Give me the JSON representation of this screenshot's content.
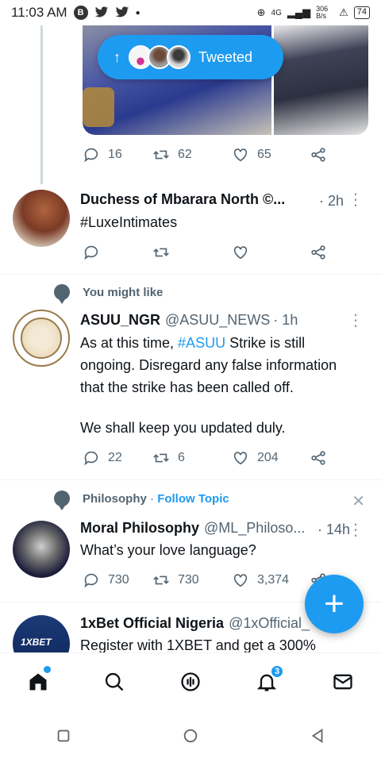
{
  "status_bar": {
    "time": "11:03 AM",
    "notif_letter": "B",
    "net_speed": "306 B/s",
    "network": "4G",
    "battery": "74"
  },
  "tweeted_pill": {
    "label": "Tweeted"
  },
  "tweets": [
    {
      "reply_count": "16",
      "retweet_count": "62",
      "like_count": "65"
    },
    {
      "name": "Duchess of Mbarara North ©...",
      "time": "· 2h",
      "text": "#LuxeIntimates",
      "reply_count": "",
      "retweet_count": "",
      "like_count": ""
    },
    {
      "context": "You might like",
      "name": "ASUU_NGR",
      "handle": "@ASUU_NEWS",
      "time": "· 1h",
      "text_before": "As at this time, ",
      "hashtag": "#ASUU",
      "text_after": " Strike is still ongoing. Disregard any false information that the strike has been called off.",
      "text_p2": "We shall keep you updated duly.",
      "reply_count": "22",
      "retweet_count": "6",
      "like_count": "204"
    },
    {
      "context_topic": "Philosophy",
      "context_sep": " · ",
      "context_follow": "Follow Topic",
      "name": "Moral Philosophy",
      "handle": "@ML_Philoso...",
      "time": "· 14h",
      "text": "What’s your love language?",
      "reply_count": "730",
      "retweet_count": "730",
      "like_count": "3,374"
    },
    {
      "name": "1xBet Official Nigeria",
      "handle": "@1xOfficial_",
      "avatar_text": "1XBET",
      "text": "Register with 1XBET and get a 300%"
    }
  ],
  "fab": {
    "label": "+"
  },
  "bottom_nav": {
    "notifications_badge": "3"
  },
  "colors": {
    "accent": "#1d9bf0",
    "muted": "#536471"
  }
}
